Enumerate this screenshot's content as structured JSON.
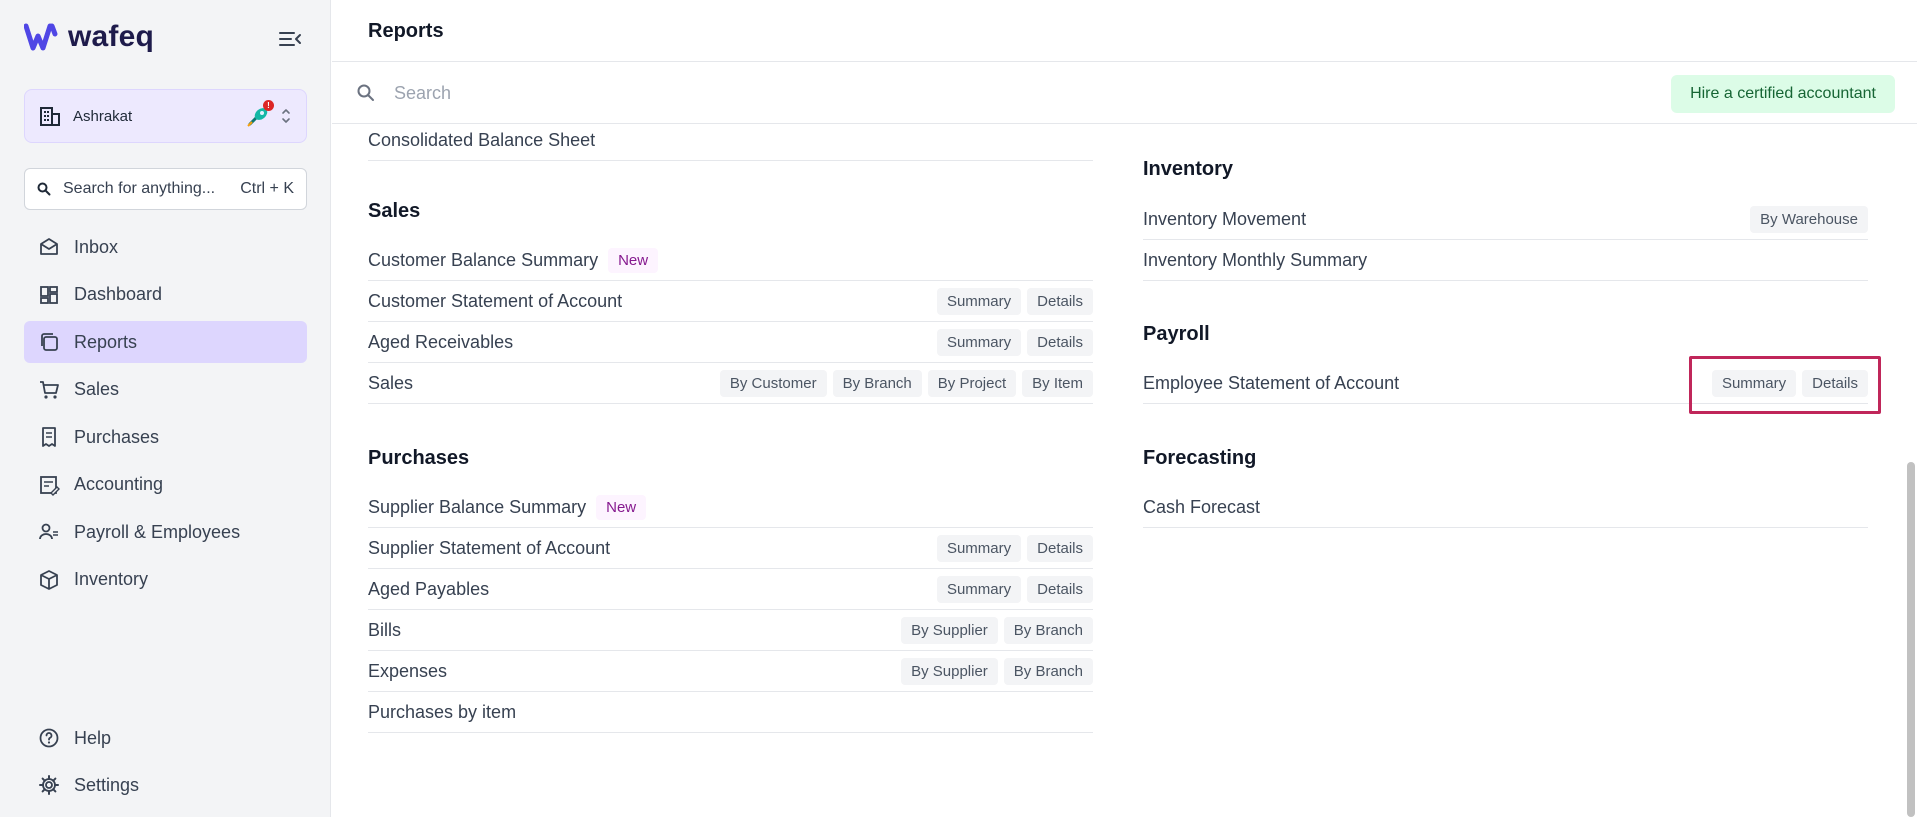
{
  "sidebar": {
    "logo_text": "wafeq",
    "org": {
      "name": "Ashrakat",
      "badge": "!"
    },
    "search": {
      "placeholder": "Search for anything...",
      "shortcut": "Ctrl + K"
    },
    "items": [
      {
        "label": "Inbox",
        "icon": "inbox-icon"
      },
      {
        "label": "Dashboard",
        "icon": "dashboard-icon"
      },
      {
        "label": "Reports",
        "icon": "reports-icon",
        "active": true
      },
      {
        "label": "Sales",
        "icon": "cart-icon"
      },
      {
        "label": "Purchases",
        "icon": "receipt-icon"
      },
      {
        "label": "Accounting",
        "icon": "ledger-icon"
      },
      {
        "label": "Payroll & Employees",
        "icon": "people-icon"
      },
      {
        "label": "Inventory",
        "icon": "box-icon"
      }
    ],
    "bottom": [
      {
        "label": "Help",
        "icon": "help-icon"
      },
      {
        "label": "Settings",
        "icon": "gear-icon"
      }
    ]
  },
  "header": {
    "title": "Reports"
  },
  "search": {
    "placeholder": "Search",
    "hire_label": "Hire a certified accountant"
  },
  "left": {
    "top_item": "Consolidated Balance Sheet",
    "sales": {
      "title": "Sales",
      "rows": [
        {
          "label": "Customer Balance Summary",
          "badge": "New",
          "tags": []
        },
        {
          "label": "Customer Statement of Account",
          "tags": [
            "Summary",
            "Details"
          ]
        },
        {
          "label": "Aged Receivables",
          "tags": [
            "Summary",
            "Details"
          ]
        },
        {
          "label": "Sales",
          "tags": [
            "By Customer",
            "By Branch",
            "By Project",
            "By Item"
          ]
        }
      ]
    },
    "purchases": {
      "title": "Purchases",
      "rows": [
        {
          "label": "Supplier Balance Summary",
          "badge": "New",
          "tags": []
        },
        {
          "label": "Supplier Statement of Account",
          "tags": [
            "Summary",
            "Details"
          ]
        },
        {
          "label": "Aged Payables",
          "tags": [
            "Summary",
            "Details"
          ]
        },
        {
          "label": "Bills",
          "tags": [
            "By Supplier",
            "By Branch"
          ]
        },
        {
          "label": "Expenses",
          "tags": [
            "By Supplier",
            "By Branch"
          ]
        },
        {
          "label": "Purchases by item",
          "tags": []
        }
      ]
    }
  },
  "right": {
    "inventory": {
      "title": "Inventory",
      "rows": [
        {
          "label": "Inventory Movement",
          "tags": [
            "By Warehouse"
          ]
        },
        {
          "label": "Inventory Monthly Summary",
          "tags": []
        }
      ]
    },
    "payroll": {
      "title": "Payroll",
      "rows": [
        {
          "label": "Employee Statement of Account",
          "tags": [
            "Summary",
            "Details"
          ]
        }
      ]
    },
    "forecasting": {
      "title": "Forecasting",
      "rows": [
        {
          "label": "Cash Forecast",
          "tags": []
        }
      ]
    }
  },
  "colors": {
    "accent": "#ddd6fe",
    "highlight": "#c0265a",
    "new_badge": "#86198f",
    "hire_bg": "#dcfce7"
  }
}
